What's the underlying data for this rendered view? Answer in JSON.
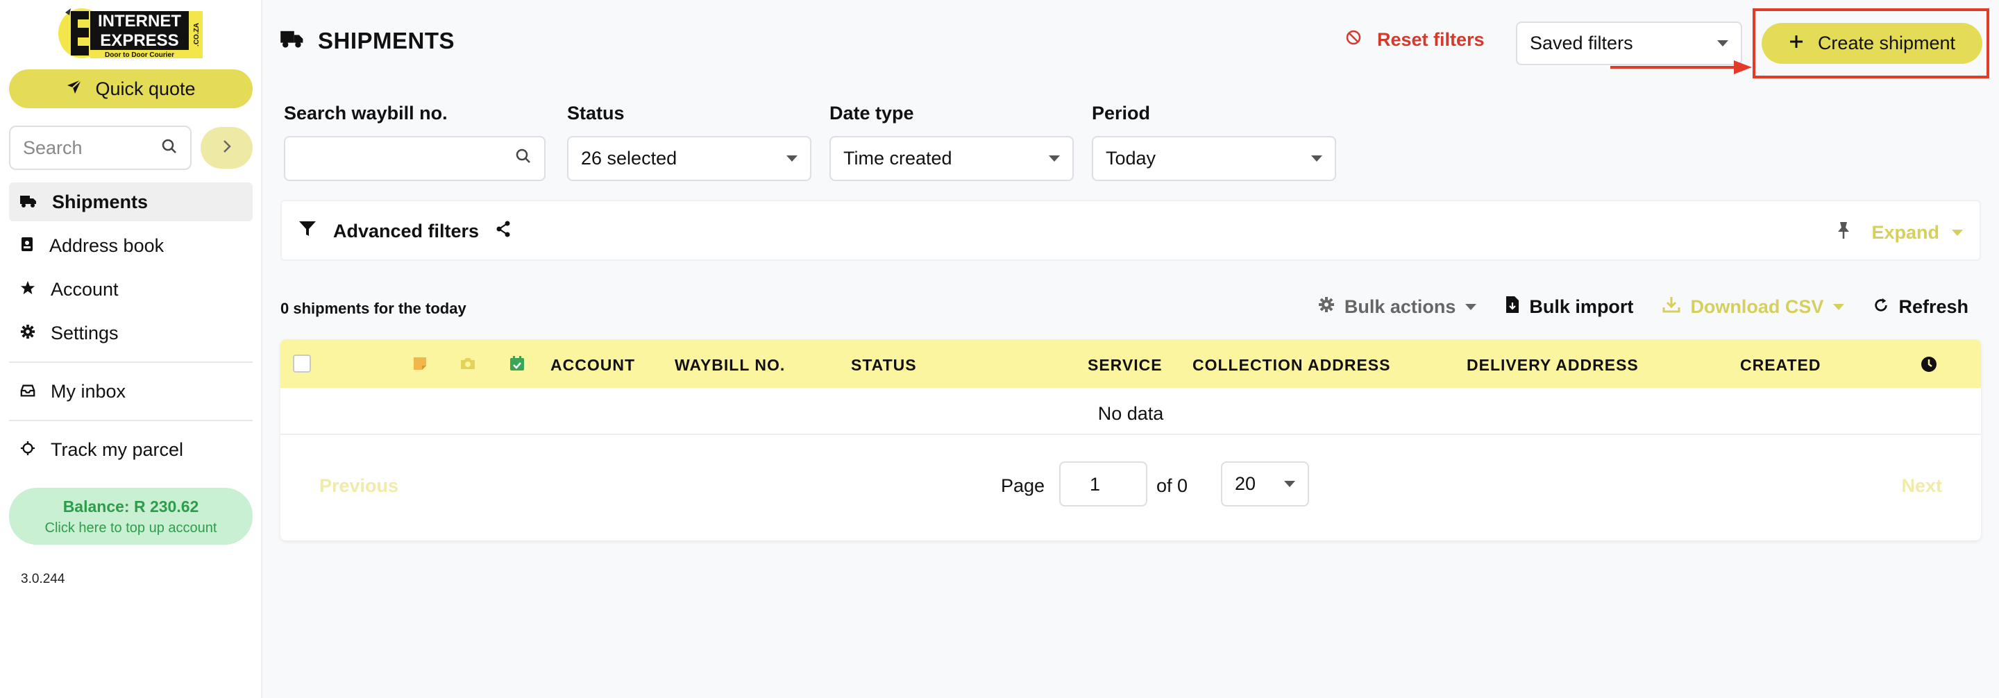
{
  "sidebar": {
    "logo": {
      "line1": "INTERNET",
      "line2": "EXPRESS",
      "tagline": "Door to Door Courier",
      "side": ".CO.ZA"
    },
    "quick_quote": "Quick quote",
    "search_placeholder": "Search",
    "nav": {
      "shipments": "Shipments",
      "address_book": "Address book",
      "account": "Account",
      "settings": "Settings",
      "inbox": "My inbox",
      "track": "Track my parcel"
    },
    "balance": {
      "amount": "Balance: R 230.62",
      "hint": "Click here to top up account"
    },
    "version": "3.0.244"
  },
  "header": {
    "title": "SHIPMENTS",
    "reset_filters": "Reset filters",
    "saved_filters": "Saved filters",
    "create_shipment": "Create shipment"
  },
  "filters": {
    "waybill": {
      "label": "Search waybill no.",
      "value": ""
    },
    "status": {
      "label": "Status",
      "value": "26 selected"
    },
    "date_type": {
      "label": "Date type",
      "value": "Time created"
    },
    "period": {
      "label": "Period",
      "value": "Today"
    }
  },
  "advanced": {
    "label": "Advanced filters",
    "expand": "Expand"
  },
  "results": {
    "count_text": "0 shipments for the today"
  },
  "toolbar": {
    "bulk_actions": "Bulk actions",
    "bulk_import": "Bulk import",
    "download_csv": "Download CSV",
    "refresh": "Refresh"
  },
  "table": {
    "columns": [
      "ACCOUNT",
      "WAYBILL NO.",
      "STATUS",
      "SERVICE",
      "COLLECTION ADDRESS",
      "DELIVERY ADDRESS",
      "CREATED"
    ],
    "empty": "No data"
  },
  "pagination": {
    "previous": "Previous",
    "page_label": "Page",
    "page": "1",
    "of": "of 0",
    "page_size": "20",
    "next": "Next"
  },
  "colors": {
    "accent": "#e4dc56",
    "header_row": "#fbf5a0",
    "danger": "#d33a2c",
    "balance_bg": "#c9f0d2",
    "balance_text": "#2e9d4b",
    "annotation": "#e23b2a"
  }
}
